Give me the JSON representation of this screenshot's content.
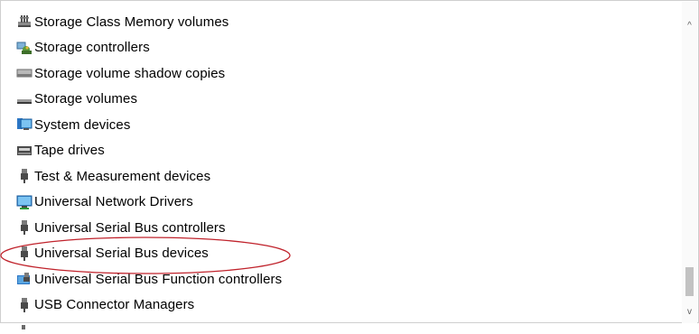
{
  "tree": {
    "items": [
      {
        "label": "Storage Class Memory volumes",
        "icon": "storage-class-memory-icon"
      },
      {
        "label": "Storage controllers",
        "icon": "storage-controller-icon"
      },
      {
        "label": "Storage volume shadow copies",
        "icon": "drive-icon"
      },
      {
        "label": "Storage volumes",
        "icon": "volume-icon"
      },
      {
        "label": "System devices",
        "icon": "system-devices-icon"
      },
      {
        "label": "Tape drives",
        "icon": "tape-drive-icon"
      },
      {
        "label": "Test & Measurement devices",
        "icon": "usb-plug-icon"
      },
      {
        "label": "Universal Network Drivers",
        "icon": "network-icon"
      },
      {
        "label": "Universal Serial Bus controllers",
        "icon": "usb-plug-icon"
      },
      {
        "label": "Universal Serial Bus devices",
        "icon": "usb-plug-icon"
      },
      {
        "label": "Universal Serial Bus Function controllers",
        "icon": "usb-function-icon"
      },
      {
        "label": "USB Connector Managers",
        "icon": "usb-plug-icon"
      }
    ]
  },
  "annotation": {
    "highlighted_item": "Universal Serial Bus devices",
    "color": "#c0232c"
  },
  "scrollbar": {
    "up_glyph": "^",
    "down_glyph": "v"
  }
}
